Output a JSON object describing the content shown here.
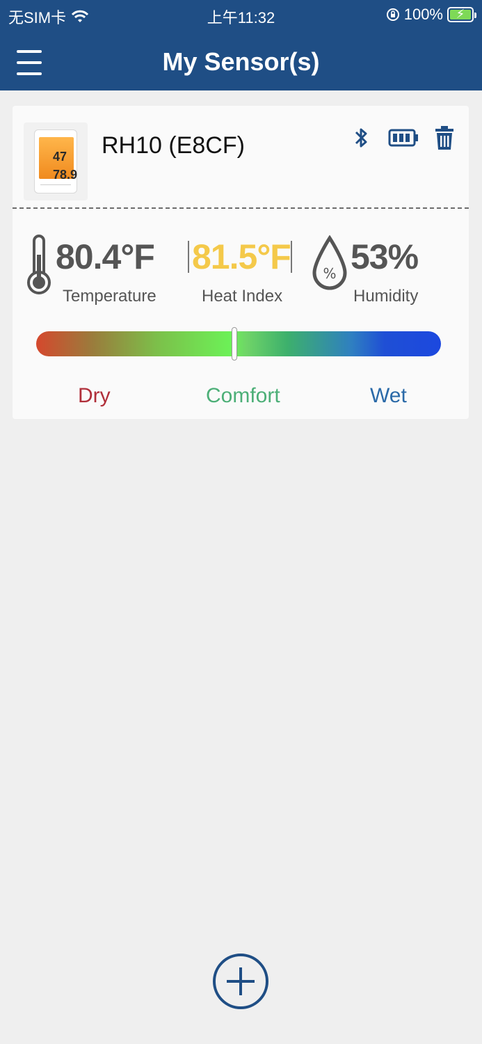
{
  "status_bar": {
    "carrier": "无SIM卡",
    "time": "上午11:32",
    "battery": "100%"
  },
  "header": {
    "title": "My Sensor(s)"
  },
  "sensor": {
    "name": "RH10 (E8CF)",
    "thumbnail_readings": [
      "47",
      "78.9"
    ],
    "temperature": {
      "value": "80.4°F",
      "label": "Temperature"
    },
    "heat_index": {
      "value": "81.5°F",
      "label": "Heat Index"
    },
    "humidity": {
      "value": "53%",
      "label": "Humidity"
    },
    "comfort_level": 0.49,
    "scale_labels": {
      "dry": "Dry",
      "comfort": "Comfort",
      "wet": "Wet"
    }
  },
  "colors": {
    "header_bg": "#1f4e85",
    "heat_index": "#f4c94a",
    "dry": "#b02f3a",
    "comfort": "#4caf77",
    "wet": "#2b6aa8",
    "icon_blue": "#1f4e85"
  },
  "icons": {
    "menu": "menu-icon",
    "bluetooth": "bluetooth-icon",
    "battery": "battery-icon",
    "delete": "trash-icon",
    "temperature": "thermometer-icon",
    "humidity": "humidity-drop-icon",
    "add": "add-circle-icon"
  }
}
